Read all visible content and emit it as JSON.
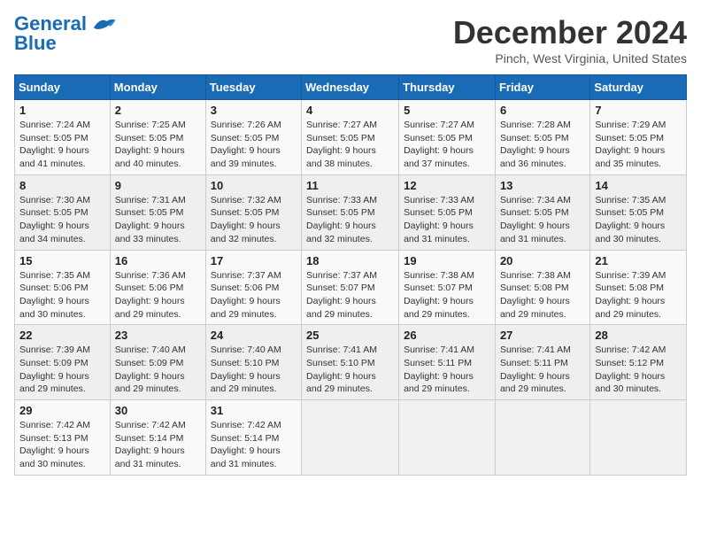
{
  "logo": {
    "line1": "General",
    "line2": "Blue"
  },
  "title": "December 2024",
  "subtitle": "Pinch, West Virginia, United States",
  "days_of_week": [
    "Sunday",
    "Monday",
    "Tuesday",
    "Wednesday",
    "Thursday",
    "Friday",
    "Saturday"
  ],
  "weeks": [
    [
      {
        "day": "1",
        "info": "Sunrise: 7:24 AM\nSunset: 5:05 PM\nDaylight: 9 hours\nand 41 minutes."
      },
      {
        "day": "2",
        "info": "Sunrise: 7:25 AM\nSunset: 5:05 PM\nDaylight: 9 hours\nand 40 minutes."
      },
      {
        "day": "3",
        "info": "Sunrise: 7:26 AM\nSunset: 5:05 PM\nDaylight: 9 hours\nand 39 minutes."
      },
      {
        "day": "4",
        "info": "Sunrise: 7:27 AM\nSunset: 5:05 PM\nDaylight: 9 hours\nand 38 minutes."
      },
      {
        "day": "5",
        "info": "Sunrise: 7:27 AM\nSunset: 5:05 PM\nDaylight: 9 hours\nand 37 minutes."
      },
      {
        "day": "6",
        "info": "Sunrise: 7:28 AM\nSunset: 5:05 PM\nDaylight: 9 hours\nand 36 minutes."
      },
      {
        "day": "7",
        "info": "Sunrise: 7:29 AM\nSunset: 5:05 PM\nDaylight: 9 hours\nand 35 minutes."
      }
    ],
    [
      {
        "day": "8",
        "info": "Sunrise: 7:30 AM\nSunset: 5:05 PM\nDaylight: 9 hours\nand 34 minutes."
      },
      {
        "day": "9",
        "info": "Sunrise: 7:31 AM\nSunset: 5:05 PM\nDaylight: 9 hours\nand 33 minutes."
      },
      {
        "day": "10",
        "info": "Sunrise: 7:32 AM\nSunset: 5:05 PM\nDaylight: 9 hours\nand 32 minutes."
      },
      {
        "day": "11",
        "info": "Sunrise: 7:33 AM\nSunset: 5:05 PM\nDaylight: 9 hours\nand 32 minutes."
      },
      {
        "day": "12",
        "info": "Sunrise: 7:33 AM\nSunset: 5:05 PM\nDaylight: 9 hours\nand 31 minutes."
      },
      {
        "day": "13",
        "info": "Sunrise: 7:34 AM\nSunset: 5:05 PM\nDaylight: 9 hours\nand 31 minutes."
      },
      {
        "day": "14",
        "info": "Sunrise: 7:35 AM\nSunset: 5:05 PM\nDaylight: 9 hours\nand 30 minutes."
      }
    ],
    [
      {
        "day": "15",
        "info": "Sunrise: 7:35 AM\nSunset: 5:06 PM\nDaylight: 9 hours\nand 30 minutes."
      },
      {
        "day": "16",
        "info": "Sunrise: 7:36 AM\nSunset: 5:06 PM\nDaylight: 9 hours\nand 29 minutes."
      },
      {
        "day": "17",
        "info": "Sunrise: 7:37 AM\nSunset: 5:06 PM\nDaylight: 9 hours\nand 29 minutes."
      },
      {
        "day": "18",
        "info": "Sunrise: 7:37 AM\nSunset: 5:07 PM\nDaylight: 9 hours\nand 29 minutes."
      },
      {
        "day": "19",
        "info": "Sunrise: 7:38 AM\nSunset: 5:07 PM\nDaylight: 9 hours\nand 29 minutes."
      },
      {
        "day": "20",
        "info": "Sunrise: 7:38 AM\nSunset: 5:08 PM\nDaylight: 9 hours\nand 29 minutes."
      },
      {
        "day": "21",
        "info": "Sunrise: 7:39 AM\nSunset: 5:08 PM\nDaylight: 9 hours\nand 29 minutes."
      }
    ],
    [
      {
        "day": "22",
        "info": "Sunrise: 7:39 AM\nSunset: 5:09 PM\nDaylight: 9 hours\nand 29 minutes."
      },
      {
        "day": "23",
        "info": "Sunrise: 7:40 AM\nSunset: 5:09 PM\nDaylight: 9 hours\nand 29 minutes."
      },
      {
        "day": "24",
        "info": "Sunrise: 7:40 AM\nSunset: 5:10 PM\nDaylight: 9 hours\nand 29 minutes."
      },
      {
        "day": "25",
        "info": "Sunrise: 7:41 AM\nSunset: 5:10 PM\nDaylight: 9 hours\nand 29 minutes."
      },
      {
        "day": "26",
        "info": "Sunrise: 7:41 AM\nSunset: 5:11 PM\nDaylight: 9 hours\nand 29 minutes."
      },
      {
        "day": "27",
        "info": "Sunrise: 7:41 AM\nSunset: 5:11 PM\nDaylight: 9 hours\nand 29 minutes."
      },
      {
        "day": "28",
        "info": "Sunrise: 7:42 AM\nSunset: 5:12 PM\nDaylight: 9 hours\nand 30 minutes."
      }
    ],
    [
      {
        "day": "29",
        "info": "Sunrise: 7:42 AM\nSunset: 5:13 PM\nDaylight: 9 hours\nand 30 minutes."
      },
      {
        "day": "30",
        "info": "Sunrise: 7:42 AM\nSunset: 5:14 PM\nDaylight: 9 hours\nand 31 minutes."
      },
      {
        "day": "31",
        "info": "Sunrise: 7:42 AM\nSunset: 5:14 PM\nDaylight: 9 hours\nand 31 minutes."
      },
      {
        "day": "",
        "info": ""
      },
      {
        "day": "",
        "info": ""
      },
      {
        "day": "",
        "info": ""
      },
      {
        "day": "",
        "info": ""
      }
    ]
  ]
}
